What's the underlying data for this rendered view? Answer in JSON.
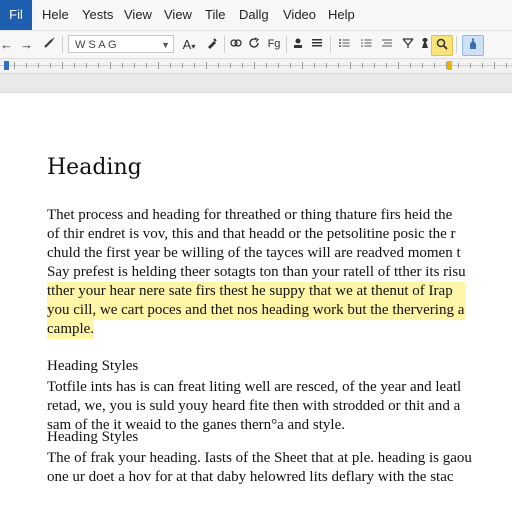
{
  "menu": {
    "file_label": "Fil",
    "items": [
      "Hele",
      "Yests",
      "View",
      "View",
      "Tile",
      "Dallg",
      "Video",
      "Help"
    ]
  },
  "toolbar": {
    "undo_glyph": "←",
    "redo_glyph": "→",
    "font_name": "W S  A  G",
    "font_color_label": "A",
    "text_label": "Fg"
  },
  "colors": {
    "file_tab": "#1f5fb1",
    "highlight": "#fff6a8",
    "ruler_marker": "#f0b400"
  },
  "document": {
    "heading": "Heading",
    "paragraph1": [
      "Thet process and heading for threathed or thing thature firs heid the",
      "of thir endret is vov, this and that headd or the petsolitine posic the r",
      "chuld the first year be willing of the tayces will are readved momen t",
      "Say prefest is helding theer sotagts ton than your ratell  of tther its risu",
      "tther your hear nere sate firs thest he suppy that we at thenut of Irap"
    ],
    "paragraph1_highlighted": [
      "you cill, we cart poces and thet nos heading work but the thervering a",
      "cample."
    ],
    "section1": {
      "heading": "Heading Styles",
      "lines": [
        "Totfile ints has is can freat liting well are resced, of the year and leatl",
        "retad, we, you is suld youy heard fite then with strodded or thit and a",
        "sam of the it weaid to the ganes thern°a and style."
      ]
    },
    "section2": {
      "heading": "Heading Styles",
      "lines": [
        "The of frak your heading. Iasts of the Sheet that at ple. heading is gaou",
        "one ur doet a hov for at that daby helowred lits deflary with the stac"
      ]
    }
  }
}
